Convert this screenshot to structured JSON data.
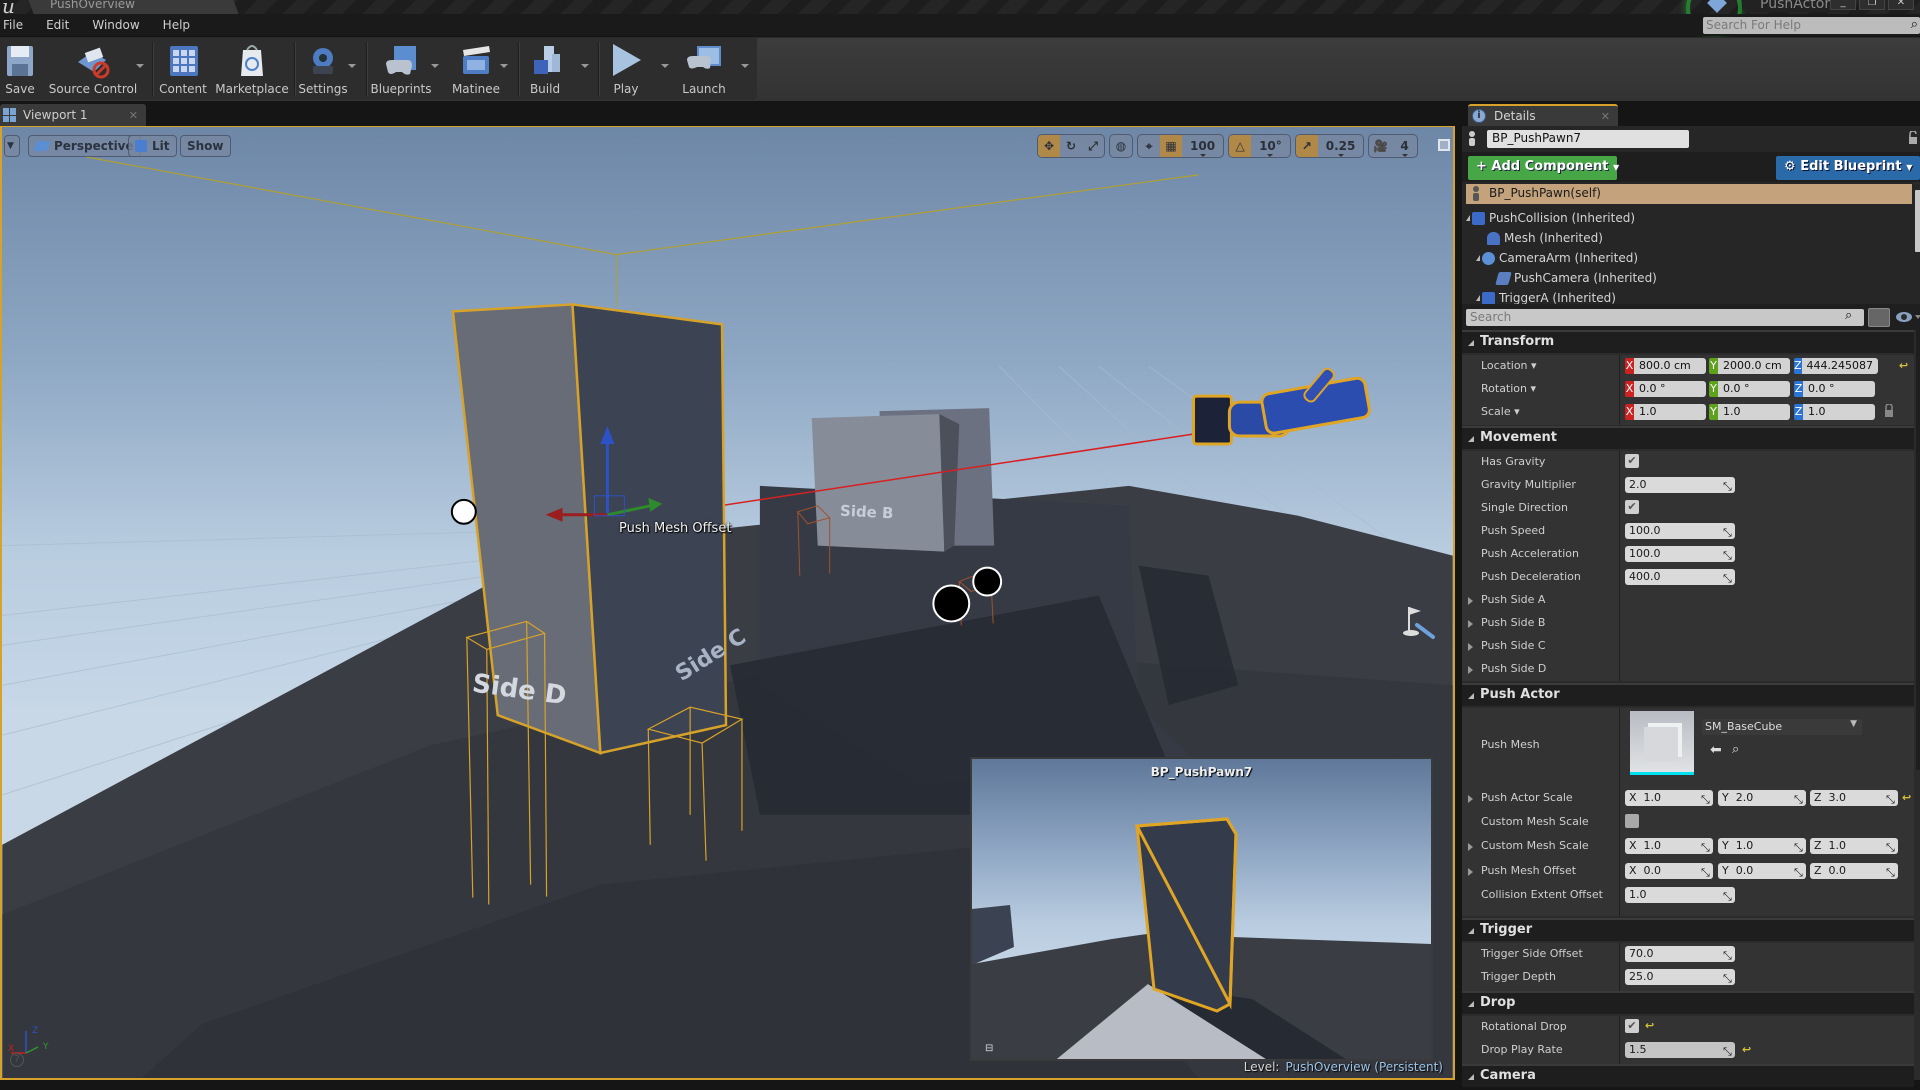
{
  "titlebar": {
    "tab_title": "PushOverview",
    "project_name": "PushActor",
    "window_controls": [
      "minimize",
      "restore",
      "close"
    ],
    "help_search_placeholder": "Search For Help"
  },
  "menu": [
    "File",
    "Edit",
    "Window",
    "Help"
  ],
  "toolbar": [
    {
      "label": "Save",
      "icon": "save-icon"
    },
    {
      "label": "Source Control",
      "icon": "source-control-icon",
      "dropdown": true
    },
    {
      "label": "Content",
      "icon": "content-icon"
    },
    {
      "label": "Marketplace",
      "icon": "marketplace-icon"
    },
    {
      "label": "Settings",
      "icon": "settings-icon",
      "dropdown": true
    },
    {
      "label": "Blueprints",
      "icon": "blueprints-icon",
      "dropdown": true
    },
    {
      "label": "Matinee",
      "icon": "matinee-icon",
      "dropdown": true
    },
    {
      "label": "Build",
      "icon": "build-icon",
      "dropdown": true
    },
    {
      "label": "Play",
      "icon": "play-icon",
      "dropdown": true
    },
    {
      "label": "Launch",
      "icon": "launch-icon",
      "dropdown": true
    }
  ],
  "viewport": {
    "tab_label": "Viewport 1",
    "view_mode_buttons": [
      "Perspective",
      "Lit",
      "Show"
    ],
    "grid_snap": "100",
    "rotation_snap": "10°",
    "scale_snap": "0.25",
    "camera_speed": "4",
    "scene_labels": {
      "gizmo_label": "Push Mesh Offset",
      "side_b": "Side B",
      "side_c": "Side C",
      "side_d": "Side D"
    },
    "preview": {
      "title": "BP_PushPawn7"
    },
    "level_prefix": "Level:",
    "level_name": "PushOverview (Persistent)",
    "axis_labels": [
      "X",
      "Y",
      "Z"
    ],
    "colors": {
      "selection": "#d7a22a",
      "trace_line": "#d82020"
    }
  },
  "details": {
    "tab_label": "Details",
    "actor_name": "BP_PushPawn7",
    "add_component_label": "+ Add Component",
    "edit_blueprint_label": "Edit Blueprint",
    "self_label": "BP_PushPawn(self)",
    "components": [
      {
        "label": "PushCollision (Inherited)",
        "depth": 0,
        "expanded": true,
        "icon": "box-collision-icon"
      },
      {
        "label": "Mesh (Inherited)",
        "depth": 1,
        "icon": "static-mesh-icon"
      },
      {
        "label": "CameraArm (Inherited)",
        "depth": 1,
        "expanded": true,
        "icon": "spring-arm-icon"
      },
      {
        "label": "PushCamera (Inherited)",
        "depth": 2,
        "icon": "camera-icon"
      },
      {
        "label": "TriggerA (Inherited)",
        "depth": 1,
        "expanded": true,
        "icon": "box-collision-icon"
      }
    ],
    "search_placeholder": "Search",
    "transform": {
      "title": "Transform",
      "location": {
        "label": "Location",
        "x": "800.0 cm",
        "y": "2000.0 cm",
        "z": "444.245087"
      },
      "rotation": {
        "label": "Rotation",
        "x": "0.0 °",
        "y": "0.0 °",
        "z": "0.0 °"
      },
      "scale": {
        "label": "Scale",
        "x": "1.0",
        "y": "1.0",
        "z": "1.0"
      }
    },
    "movement": {
      "title": "Movement",
      "has_gravity": {
        "label": "Has Gravity",
        "checked": true
      },
      "gravity_multiplier": {
        "label": "Gravity Multiplier",
        "value": "2.0"
      },
      "single_direction": {
        "label": "Single Direction",
        "checked": true
      },
      "push_speed": {
        "label": "Push Speed",
        "value": "100.0"
      },
      "push_acceleration": {
        "label": "Push Acceleration",
        "value": "100.0"
      },
      "push_deceleration": {
        "label": "Push Deceleration",
        "value": "400.0"
      },
      "push_sides": [
        "Push Side A",
        "Push Side B",
        "Push Side C",
        "Push Side D"
      ]
    },
    "push_actor": {
      "title": "Push Actor",
      "push_mesh": {
        "label": "Push Mesh",
        "value": "SM_BaseCube"
      },
      "push_actor_scale": {
        "label": "Push Actor Scale",
        "x": "1.0",
        "y": "2.0",
        "z": "3.0"
      },
      "custom_mesh_scale_toggle": {
        "label": "Custom Mesh Scale",
        "checked": false
      },
      "custom_mesh_scale": {
        "label": "Custom Mesh Scale",
        "x": "1.0",
        "y": "1.0",
        "z": "1.0"
      },
      "push_mesh_offset": {
        "label": "Push Mesh Offset",
        "x": "0.0",
        "y": "0.0",
        "z": "0.0"
      },
      "collision_extent_offset": {
        "label": "Collision Extent Offset",
        "value": "1.0"
      }
    },
    "trigger": {
      "title": "Trigger",
      "trigger_side_offset": {
        "label": "Trigger Side Offset",
        "value": "70.0"
      },
      "trigger_depth": {
        "label": "Trigger Depth",
        "value": "25.0"
      }
    },
    "drop": {
      "title": "Drop",
      "rotational_drop": {
        "label": "Rotational Drop",
        "checked": true
      },
      "drop_play_rate": {
        "label": "Drop Play Rate",
        "value": "1.5"
      }
    },
    "camera": {
      "title": "Camera"
    }
  }
}
